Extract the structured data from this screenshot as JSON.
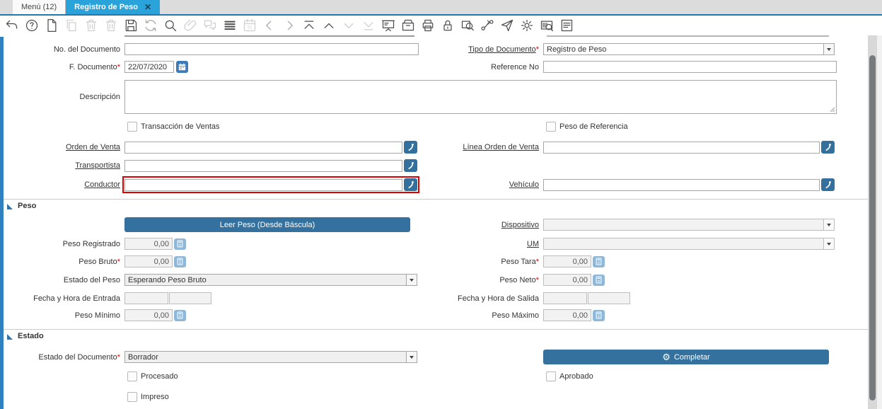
{
  "tab_bar": {
    "menu_tab": "Menú (12)",
    "active_tab": "Registro de Peso",
    "close_glyph": "✕"
  },
  "toolbar": {
    "items": [
      {
        "name": "undo",
        "state": "enabled"
      },
      {
        "name": "help",
        "state": "enabled"
      },
      {
        "name": "new-record",
        "state": "enabled"
      },
      {
        "name": "copy-record",
        "state": "disabled"
      },
      {
        "name": "delete-record",
        "state": "disabled"
      },
      {
        "name": "delete-selection",
        "state": "disabled"
      },
      {
        "name": "save",
        "state": "enabled"
      },
      {
        "name": "refresh",
        "state": "medium"
      },
      {
        "name": "find",
        "state": "enabled"
      },
      {
        "name": "attachment",
        "state": "disabled"
      },
      {
        "name": "chat",
        "state": "disabled"
      },
      {
        "name": "grid-toggle",
        "state": "enabled"
      },
      {
        "name": "calendar",
        "state": "disabled"
      },
      {
        "name": "previous-record",
        "state": "medium"
      },
      {
        "name": "next-record",
        "state": "medium"
      },
      {
        "name": "first-record",
        "state": "enabled"
      },
      {
        "name": "parent-record",
        "state": "enabled"
      },
      {
        "name": "detail-record",
        "state": "disabled"
      },
      {
        "name": "last-record",
        "state": "disabled"
      },
      {
        "name": "report",
        "state": "enabled"
      },
      {
        "name": "archive",
        "state": "enabled"
      },
      {
        "name": "print",
        "state": "enabled"
      },
      {
        "name": "lock",
        "state": "enabled"
      },
      {
        "name": "zoom-across",
        "state": "enabled"
      },
      {
        "name": "workflow",
        "state": "enabled"
      },
      {
        "name": "send-mail",
        "state": "enabled"
      },
      {
        "name": "preferences",
        "state": "enabled"
      },
      {
        "name": "product-info",
        "state": "enabled"
      },
      {
        "name": "report-window",
        "state": "enabled"
      }
    ]
  },
  "form": {
    "required_marker": "*",
    "no_documento_label": "No. del Documento",
    "tipo_documento_label": "Tipo de Documento",
    "tipo_documento_value": "Registro de Peso",
    "f_documento_label": "F. Documento",
    "f_documento_value": "22/07/2020",
    "reference_no_label": "Reference No",
    "descripcion_label": "Descripción",
    "transaccion_ventas_label": "Transacción de Ventas",
    "peso_referencia_label": "Peso de Referencia",
    "orden_venta_label": "Orden de Venta",
    "linea_orden_venta_label": "Línea Orden de Venta",
    "transportista_label": "Transportista",
    "conductor_label": "Conductor",
    "vehiculo_label": "Vehículo"
  },
  "peso_section": {
    "title": "Peso",
    "leer_peso_button": "Leer Peso (Desde Báscula)",
    "dispositivo_label": "Dispositivo",
    "peso_registrado_label": "Peso Registrado",
    "peso_registrado_value": "0,00",
    "um_label": "UM",
    "peso_bruto_label": "Peso Bruto",
    "peso_bruto_value": "0,00",
    "peso_tara_label": "Peso Tara",
    "peso_tara_value": "0,00",
    "estado_peso_label": "Estado del Peso",
    "estado_peso_value": "Esperando Peso Bruto",
    "peso_neto_label": "Peso Neto",
    "peso_neto_value": "0,00",
    "fecha_entrada_label": "Fecha y Hora de Entrada",
    "fecha_salida_label": "Fecha y Hora de Salida",
    "peso_minimo_label": "Peso Mínimo",
    "peso_minimo_value": "0,00",
    "peso_maximo_label": "Peso Máximo",
    "peso_maximo_value": "0,00"
  },
  "estado_section": {
    "title": "Estado",
    "estado_documento_label": "Estado del Documento",
    "estado_documento_value": "Borrador",
    "completar_button": "Completar",
    "completar_gear_glyph": "⚙",
    "procesado_label": "Procesado",
    "aprobado_label": "Aprobado",
    "impreso_label": "Impreso"
  },
  "colors": {
    "active_tab": "#2aa3db",
    "tab_underline": "#2379ab",
    "button_blue": "#34719f",
    "calc_button_blue": "#8fb7d7",
    "calendar_button_blue": "#3f7ab8",
    "highlight_red": "#dd0000",
    "left_strip_blue": "#3180c0"
  }
}
